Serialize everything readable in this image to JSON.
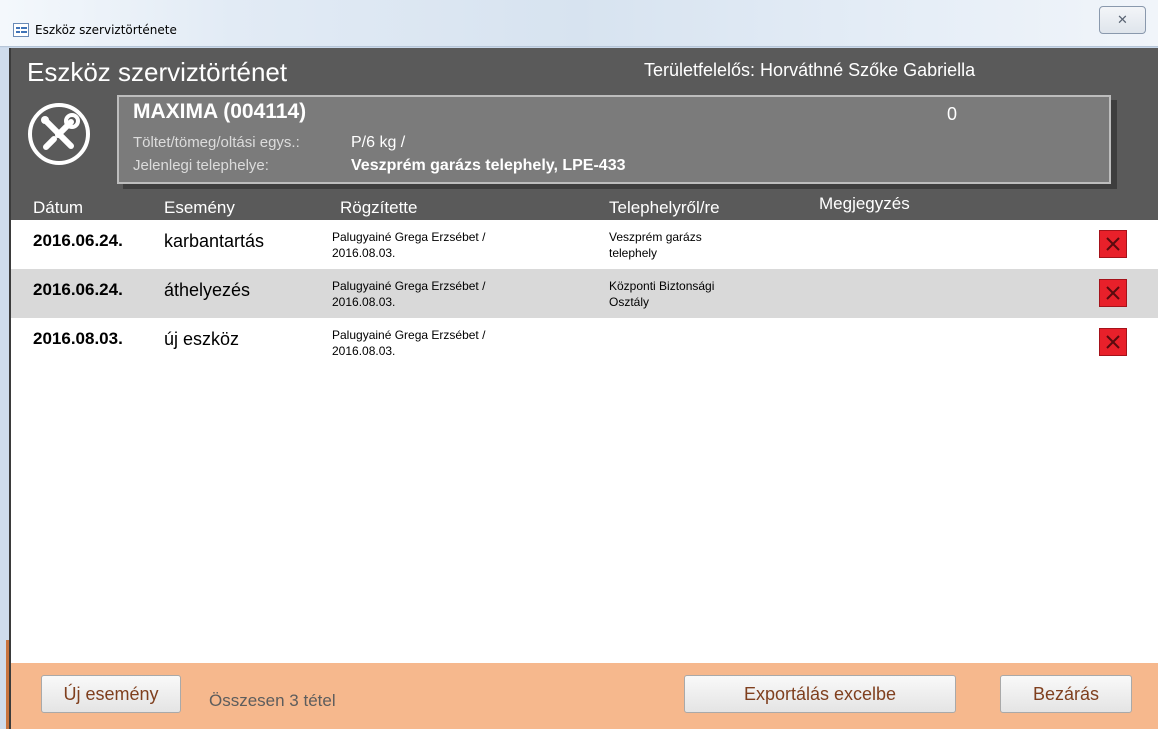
{
  "window": {
    "title": "Eszköz szerviztörténete",
    "close_glyph": "✕"
  },
  "header": {
    "title": "Eszköz szerviztörténet",
    "manager": "Területfelelős: Horváthné Szőke Gabriella"
  },
  "device": {
    "name": "MAXIMA (004114)",
    "count": "0",
    "fill_label": "Töltet/tömeg/oltási egys.:",
    "fill_value": "P/6 kg /",
    "location_label": "Jelenlegi telephelye:",
    "location_value": "Veszprém garázs telephely, LPE-433"
  },
  "columns": {
    "date": "Dátum",
    "event": "Esemény",
    "recorded_by": "Rögzítette",
    "location": "Telephelyről/re",
    "note": "Megjegyzés"
  },
  "rows": [
    {
      "date": "2016.06.24.",
      "event": "karbantartás",
      "by_line1": "Palugyainé Grega Erzsébet /",
      "by_line2": "2016.08.03.",
      "place_line1": "Veszprém garázs",
      "place_line2": "telephely"
    },
    {
      "date": "2016.06.24.",
      "event": "áthelyezés",
      "by_line1": "Palugyainé Grega Erzsébet /",
      "by_line2": "2016.08.03.",
      "place_line1": "Központi Biztonsági",
      "place_line2": "Osztály"
    },
    {
      "date": "2016.08.03.",
      "event": "új eszköz",
      "by_line1": "Palugyainé Grega Erzsébet /",
      "by_line2": "2016.08.03.",
      "place_line1": "",
      "place_line2": ""
    }
  ],
  "footer": {
    "new_event": "Új esemény",
    "total": "Összesen 3 tétel",
    "export": "Exportálás excelbe",
    "close": "Bezárás"
  },
  "colors": {
    "header_bg": "#5a5a5a",
    "card_bg": "#7b7b7b",
    "footer_bg": "#f6b88d",
    "delete_red": "#e8202a",
    "alt_row": "#d9d9d9"
  },
  "icons": [
    "form-icon",
    "tools-icon",
    "delete-icon",
    "close-icon"
  ]
}
